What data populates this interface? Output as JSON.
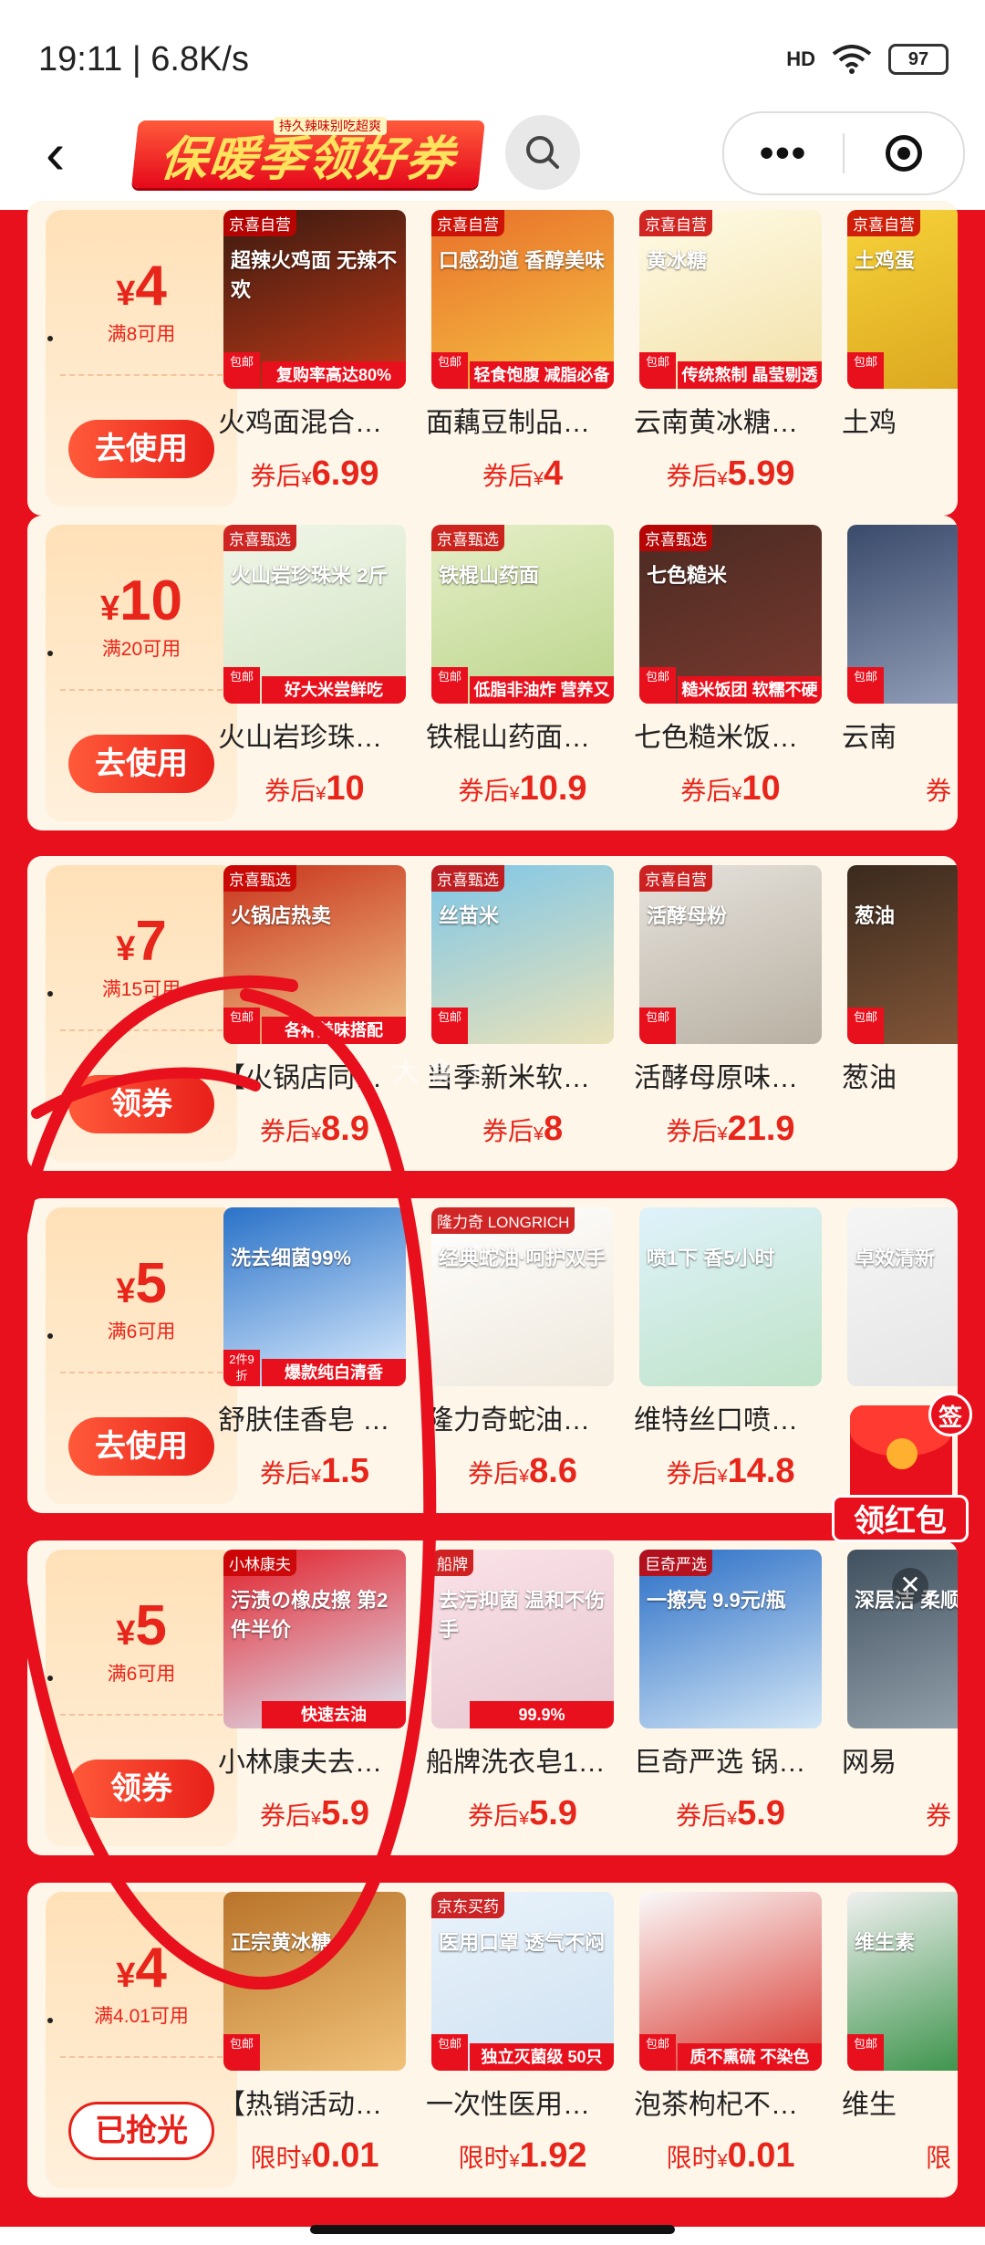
{
  "status": {
    "time": "19:11 | 6.8K/s",
    "signal": "HD",
    "battery": "97"
  },
  "header": {
    "title": "保暖季领好券",
    "subtitle": "持久辣味别吃超爽"
  },
  "colors": {
    "accent": "#e8101c",
    "price": "#e8251a",
    "coupon_bg": "#ffe1b8"
  },
  "rows": [
    {
      "coupon": {
        "yen": "¥",
        "amount": "4",
        "condition": "满8可用",
        "button": "去使用"
      },
      "products": [
        {
          "title": "火鸡面混合…",
          "price_label": "券后",
          "yen": "¥",
          "price": "6.99",
          "tag": "京喜自营",
          "image_text": "超辣火鸡面 无辣不欢",
          "strip": "复购率高达80%",
          "badge": "包邮"
        },
        {
          "title": "面藕豆制品…",
          "price_label": "券后",
          "yen": "¥",
          "price": "4",
          "tag": "京喜自营",
          "image_text": "口感劲道 香醇美味",
          "strip": "轻食饱腹 减脂必备",
          "badge": "包邮"
        },
        {
          "title": "云南黄冰糖…",
          "price_label": "券后",
          "yen": "¥",
          "price": "5.99",
          "tag": "京喜自营",
          "image_text": "黄冰糖",
          "strip": "传统熬制 晶莹剔透",
          "badge": "包邮"
        },
        {
          "title": "土鸡",
          "price_label": "",
          "yen": "",
          "price": "",
          "tag": "京喜自营",
          "image_text": "土鸡蛋",
          "strip": "",
          "badge": "包邮"
        }
      ]
    },
    {
      "coupon": {
        "yen": "¥",
        "amount": "10",
        "condition": "满20可用",
        "button": "去使用"
      },
      "products": [
        {
          "title": "火山岩珍珠…",
          "price_label": "券后",
          "yen": "¥",
          "price": "10",
          "tag": "京喜甄选",
          "image_text": "火山岩珍珠米 2斤",
          "strip": "好大米尝鲜吃",
          "badge": "包邮"
        },
        {
          "title": "铁棍山药面…",
          "price_label": "券后",
          "yen": "¥",
          "price": "10.9",
          "tag": "京喜甄选",
          "image_text": "铁棍山药面",
          "strip": "低脂非油炸 营养又健康",
          "badge": "包邮"
        },
        {
          "title": "七色糙米饭…",
          "price_label": "券后",
          "yen": "¥",
          "price": "10",
          "tag": "京喜甄选",
          "image_text": "七色糙米",
          "strip": "糙米饭团 软糯不硬",
          "badge": "包邮"
        },
        {
          "title": "云南",
          "price_label": "券",
          "yen": "",
          "price": "",
          "tag": "",
          "image_text": "",
          "strip": "",
          "badge": "包邮"
        }
      ]
    },
    {
      "coupon": {
        "yen": "¥",
        "amount": "7",
        "condition": "满15可用",
        "button": "领券"
      },
      "products": [
        {
          "title": "【火锅店同…",
          "price_label": "券后",
          "yen": "¥",
          "price": "8.9",
          "tag": "京喜甄选",
          "image_text": "火锅店热卖",
          "strip": "各种美味搭配",
          "badge": "包邮"
        },
        {
          "title": "当季新米软…",
          "price_label": "券后",
          "yen": "¥",
          "price": "8",
          "tag": "京喜甄选",
          "image_text": "丝苗米",
          "strip": "",
          "badge": "包邮"
        },
        {
          "title": "活酵母原味…",
          "price_label": "券后",
          "yen": "¥",
          "price": "21.9",
          "tag": "京喜自营",
          "image_text": "活酵母粉",
          "strip": "",
          "badge": "包邮"
        },
        {
          "title": "葱油",
          "price_label": "",
          "yen": "",
          "price": "",
          "tag": "",
          "image_text": "葱油",
          "strip": "",
          "badge": "包邮"
        }
      ]
    },
    {
      "coupon": {
        "yen": "¥",
        "amount": "5",
        "condition": "满6可用",
        "button": "去使用"
      },
      "products": [
        {
          "title": "舒肤佳香皂 …",
          "price_label": "券后",
          "yen": "¥",
          "price": "1.5",
          "tag": "",
          "image_text": "洗去细菌99%",
          "strip": "爆款纯白清香",
          "badge": "2件9折"
        },
        {
          "title": "隆力奇蛇油…",
          "price_label": "券后",
          "yen": "¥",
          "price": "8.6",
          "tag": "隆力奇 LONGRICH",
          "image_text": "经典蛇油·呵护双手",
          "strip": "",
          "badge": ""
        },
        {
          "title": "维特丝口喷…",
          "price_label": "券后",
          "yen": "¥",
          "price": "14.8",
          "tag": "",
          "image_text": "喷1下 香5小时",
          "strip": "",
          "badge": ""
        },
        {
          "title": "",
          "price_label": "",
          "yen": "",
          "price": "",
          "tag": "",
          "image_text": "卓效清新",
          "strip": "",
          "badge": ""
        }
      ]
    },
    {
      "coupon": {
        "yen": "¥",
        "amount": "5",
        "condition": "满6可用",
        "button": "领券"
      },
      "products": [
        {
          "title": "小林康夫去…",
          "price_label": "券后",
          "yen": "¥",
          "price": "5.9",
          "tag": "小林康夫",
          "image_text": "污渍の橡皮擦 第2件半价",
          "strip": "快速去油",
          "badge": ""
        },
        {
          "title": "船牌洗衣皂1…",
          "price_label": "券后",
          "yen": "¥",
          "price": "5.9",
          "tag": "船牌",
          "image_text": "去污抑菌 温和不伤手",
          "strip": "99.9%",
          "badge": ""
        },
        {
          "title": "巨奇严选 锅…",
          "price_label": "券后",
          "yen": "¥",
          "price": "5.9",
          "tag": "巨奇严选",
          "image_text": "一擦亮 9.9元/瓶",
          "strip": "",
          "badge": ""
        },
        {
          "title": "网易",
          "price_label": "券",
          "yen": "",
          "price": "",
          "tag": "",
          "image_text": "深层洁 柔顺护色",
          "strip": "",
          "badge": ""
        }
      ]
    },
    {
      "coupon": {
        "yen": "¥",
        "amount": "4",
        "condition": "满4.01可用",
        "button": "已抢光"
      },
      "products": [
        {
          "title": "【热销活动…",
          "price_label": "限时",
          "yen": "¥",
          "price": "0.01",
          "tag": "",
          "image_text": "正宗黄冰糖",
          "strip": "",
          "badge": "包邮"
        },
        {
          "title": "一次性医用…",
          "price_label": "限时",
          "yen": "¥",
          "price": "1.92",
          "tag": "京东买药",
          "image_text": "医用口罩 透气不闷",
          "strip": "独立灭菌级 50只",
          "badge": "包邮"
        },
        {
          "title": "泡茶枸杞不…",
          "price_label": "限时",
          "yen": "¥",
          "price": "0.01",
          "tag": "",
          "image_text": "",
          "strip": "质不熏硫 不染色",
          "badge": "包邮"
        },
        {
          "title": "维生",
          "price_label": "限",
          "yen": "",
          "price": "",
          "tag": "",
          "image_text": "维生素",
          "strip": "",
          "badge": "包邮"
        }
      ]
    }
  ],
  "floating": {
    "sign": "签",
    "label": "领红包",
    "close": "✕"
  },
  "watermark": "大 食 卡"
}
